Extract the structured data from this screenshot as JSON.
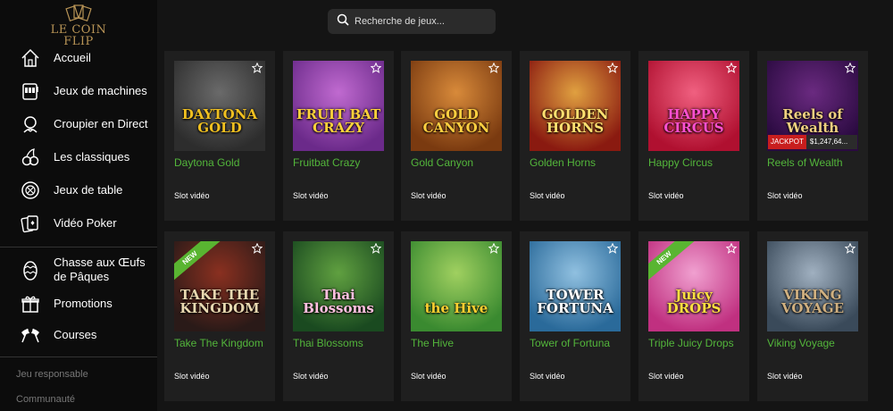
{
  "brand": {
    "logo_text": "LE COIN FLIP"
  },
  "nav": {
    "items": [
      {
        "label": "Accueil",
        "icon": "home-icon"
      },
      {
        "label": "Jeux de machines",
        "icon": "slot-machine-icon"
      },
      {
        "label": "Croupier en Direct",
        "icon": "dealer-icon"
      },
      {
        "label": "Les classiques",
        "icon": "cherries-icon"
      },
      {
        "label": "Jeux de table",
        "icon": "chip-icon"
      },
      {
        "label": "Vidéo Poker",
        "icon": "cards-icon"
      }
    ],
    "secondary": [
      {
        "label": "Chasse aux Œufs de Pâques",
        "icon": "easter-egg-icon"
      },
      {
        "label": "Promotions",
        "icon": "gift-icon"
      },
      {
        "label": "Courses",
        "icon": "race-flags-icon"
      }
    ],
    "footer": [
      "Jeu responsable",
      "Communauté"
    ]
  },
  "search": {
    "placeholder": "Recherche de jeux..."
  },
  "games": [
    {
      "name": "Daytona Gold",
      "type": "Slot vidéo",
      "art_title": "DAYTONA GOLD",
      "colors": [
        "#2d2d2d",
        "#6a6a6a"
      ],
      "title_color": "#f0c020",
      "badge": "",
      "jackpot": null
    },
    {
      "name": "Fruitbat Crazy",
      "type": "Slot vidéo",
      "art_title": "FRUIT BAT CRAZY",
      "colors": [
        "#6b2a8a",
        "#c06ad0"
      ],
      "title_color": "#ffd23a",
      "badge": "",
      "jackpot": null
    },
    {
      "name": "Gold Canyon",
      "type": "Slot vidéo",
      "art_title": "GOLD CANYON",
      "colors": [
        "#7a3a10",
        "#d88a3a"
      ],
      "title_color": "#ffcf40",
      "badge": "",
      "jackpot": null
    },
    {
      "name": "Golden Horns",
      "type": "Slot vidéo",
      "art_title": "GOLDEN HORNS",
      "colors": [
        "#8a1a10",
        "#e0a040"
      ],
      "title_color": "#ffe070",
      "badge": "",
      "jackpot": null
    },
    {
      "name": "Happy Circus",
      "type": "Slot vidéo",
      "art_title": "HAPPY CIRCUS",
      "colors": [
        "#b01030",
        "#f06080"
      ],
      "title_color": "#ff50d0",
      "badge": "",
      "jackpot": null
    },
    {
      "name": "Reels of Wealth",
      "type": "Slot vidéo",
      "art_title": "Reels of Wealth",
      "colors": [
        "#2a0a40",
        "#6a2a80"
      ],
      "title_color": "#f0d080",
      "badge": "",
      "jackpot": {
        "label": "JACKPOT",
        "value": "$1,247,64..."
      }
    },
    {
      "name": "Take The Kingdom",
      "type": "Slot vidéo",
      "art_title": "TAKE THE KINGDOM",
      "colors": [
        "#2a1a18",
        "#8a3020"
      ],
      "title_color": "#e8d8b0",
      "badge": "NEW",
      "jackpot": null
    },
    {
      "name": "Thai Blossoms",
      "type": "Slot vidéo",
      "art_title": "Thai Blossoms",
      "colors": [
        "#1a4a20",
        "#60a040"
      ],
      "title_color": "#ffc0e0",
      "badge": "",
      "jackpot": null
    },
    {
      "name": "The Hive",
      "type": "Slot vidéo",
      "art_title": "the Hive",
      "colors": [
        "#3a8a30",
        "#a0d060"
      ],
      "title_color": "#ffd030",
      "badge": "",
      "jackpot": null
    },
    {
      "name": "Tower of Fortuna",
      "type": "Slot vidéo",
      "art_title": "TOWER FORTUNA",
      "colors": [
        "#2a6a9a",
        "#90c0e0"
      ],
      "title_color": "#ffffff",
      "badge": "",
      "jackpot": null
    },
    {
      "name": "Triple Juicy Drops",
      "type": "Slot vidéo",
      "art_title": "Juicy DROPS",
      "colors": [
        "#c03080",
        "#f0a0d0"
      ],
      "title_color": "#ffe040",
      "badge": "NEW",
      "jackpot": null
    },
    {
      "name": "Viking Voyage",
      "type": "Slot vidéo",
      "art_title": "VIKING VOYAGE",
      "colors": [
        "#3a4a5a",
        "#a0b0c0"
      ],
      "title_color": "#d0b080",
      "badge": "",
      "jackpot": null
    }
  ],
  "colors": {
    "accent_green": "#53b63b",
    "card_bg": "#1f1f1f",
    "sidebar_bg": "#0c0c0c"
  }
}
